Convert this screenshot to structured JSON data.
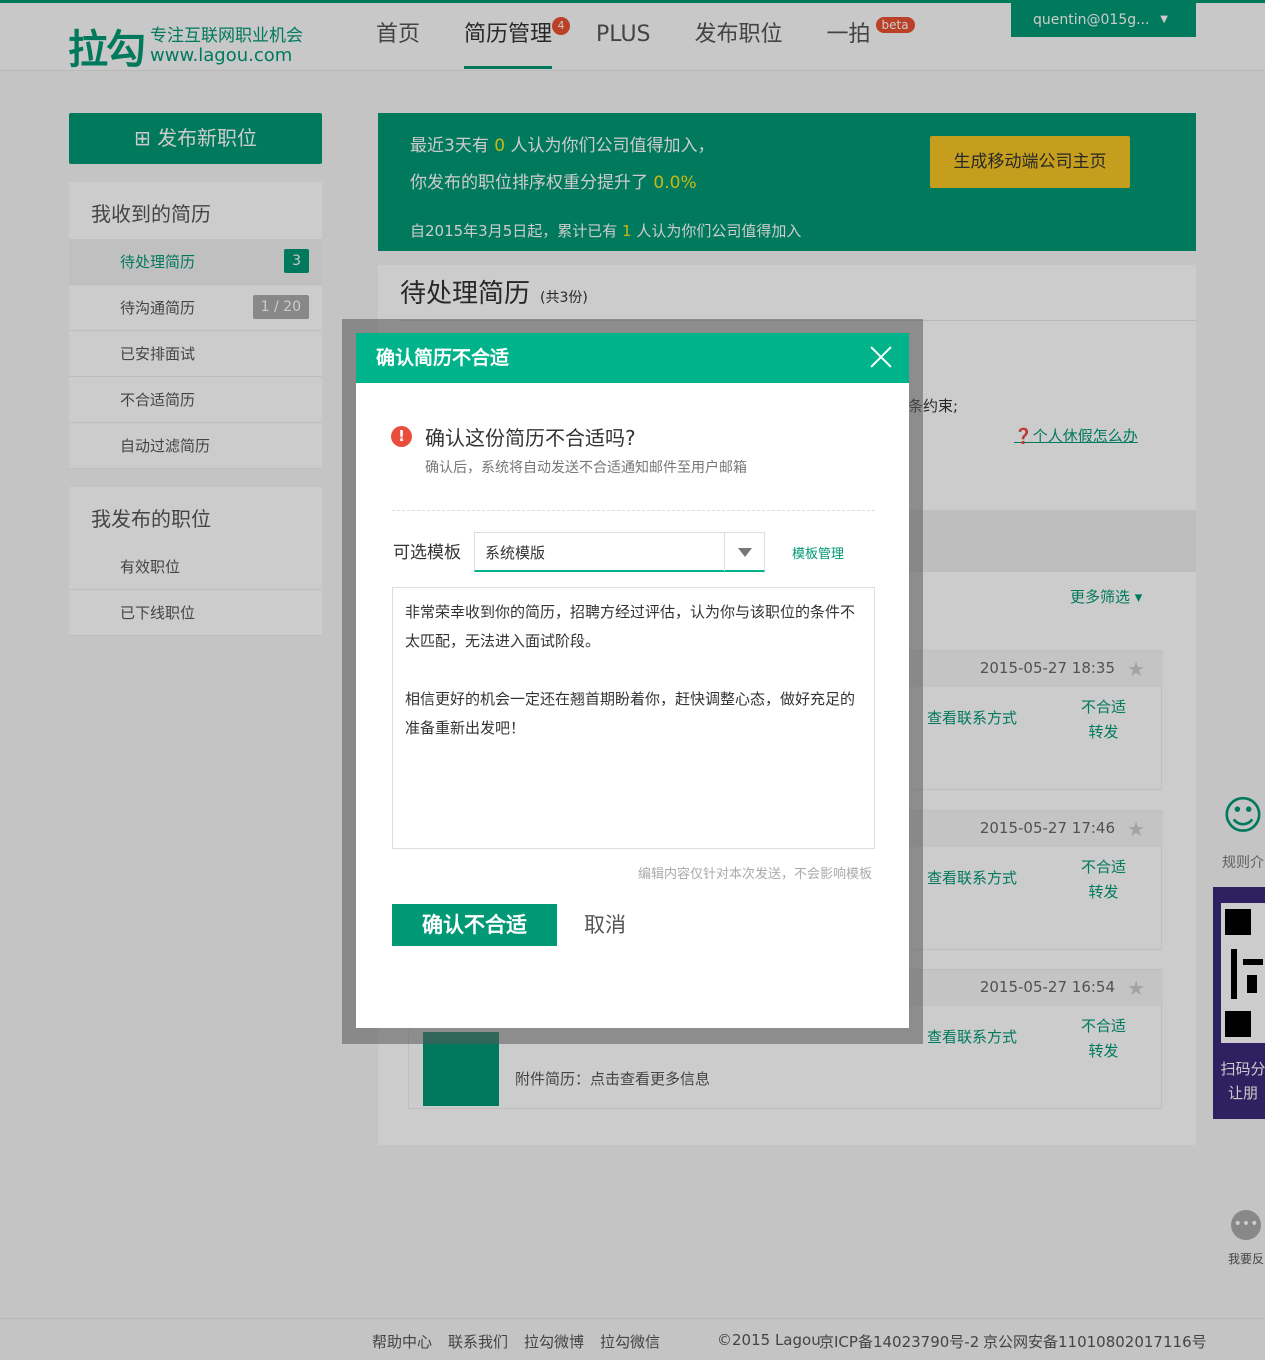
{
  "header": {
    "logo_mark": "拉勾",
    "logo_slogan": "专注互联网职业机会",
    "logo_url": "www.lagou.com",
    "nav": [
      {
        "label": "首页"
      },
      {
        "label": "简历管理",
        "badge": "4"
      },
      {
        "label": "PLUS"
      },
      {
        "label": "发布职位"
      },
      {
        "label": "一拍",
        "badge": "beta"
      }
    ],
    "user": "quentin@015g...",
    "user_caret": "▼"
  },
  "sidebar": {
    "publish_button": "发布新职位",
    "publish_icon": "plus-square-icon",
    "received_title": "我收到的简历",
    "received_items": [
      {
        "label": "待处理简历",
        "count": "3"
      },
      {
        "label": "待沟通简历",
        "count": "1 / 20"
      },
      {
        "label": "已安排面试"
      },
      {
        "label": "不合适简历"
      },
      {
        "label": "自动过滤简历"
      }
    ],
    "posted_title": "我发布的职位",
    "posted_items": [
      {
        "label": "有效职位"
      },
      {
        "label": "已下线职位"
      }
    ]
  },
  "banner": {
    "line1_pre": "最近3天有 ",
    "line1_count": "0",
    "line1_post": " 人认为你们公司值得加入，",
    "line2_pre": "你发布的职位排序权重分提升了 ",
    "line2_value": "0.0%",
    "line3_pre": "自2015年3月5日起，累计已有 ",
    "line3_count": "1",
    "line3_post": " 人认为你们公司值得加入",
    "mobile_button": "生成移动端公司主页"
  },
  "main": {
    "title": "待处理简历",
    "count_label": "(共3份)",
    "hint_tail": "条约束;",
    "vacation_link": "个人休假怎么办",
    "more_filter": "更多筛选",
    "cards": [
      {
        "date": "2015-05-27 18:35",
        "contact": "查看联系方式",
        "reject": "不合适",
        "forward": "转发"
      },
      {
        "date": "2015-05-27 17:46",
        "contact": "查看联系方式",
        "reject": "不合适",
        "forward": "转发"
      },
      {
        "date": "2015-05-27 16:54",
        "contact": "查看联系方式",
        "reject": "不合适",
        "forward": "转发",
        "attachment": "附件简历：点击查看更多信息"
      }
    ]
  },
  "floating": {
    "rule_label": "规则介",
    "scan_line1": "扫码分",
    "scan_line2": "让朋",
    "feedback": "我要反"
  },
  "footer": {
    "links": [
      "帮助中心",
      "联系我们",
      "拉勾微博",
      "拉勾微信"
    ],
    "copyright": "©2015 Lagou",
    "icp": "京ICP备14023790号-2",
    "police": "京公网安备11010802017116号"
  },
  "modal": {
    "title": "确认简历不合适",
    "question": "确认这份简历不合适吗?",
    "subtext": "确认后，系统将自动发送不合适通知邮件至用户邮箱",
    "template_label": "可选模板",
    "template_value": "系统模版",
    "template_manage": "模板管理",
    "message_p1": "非常荣幸收到你的简历，招聘方经过评估，认为你与该职位的条件不太匹配，无法进入面试阶段。",
    "message_p2": "相信更好的机会一定还在翘首期盼着你，赶快调整心态，做好充足的准备重新出发吧！",
    "note": "编辑内容仅针对本次发送，不会影响模板",
    "confirm_button": "确认不合适",
    "cancel_button": "取消"
  },
  "colors": {
    "brand_green": "#019875",
    "modal_green": "#00b38a",
    "highlight_yellow": "#f8e71c",
    "button_yellow": "#f5c623",
    "badge_red": "#e95032"
  }
}
